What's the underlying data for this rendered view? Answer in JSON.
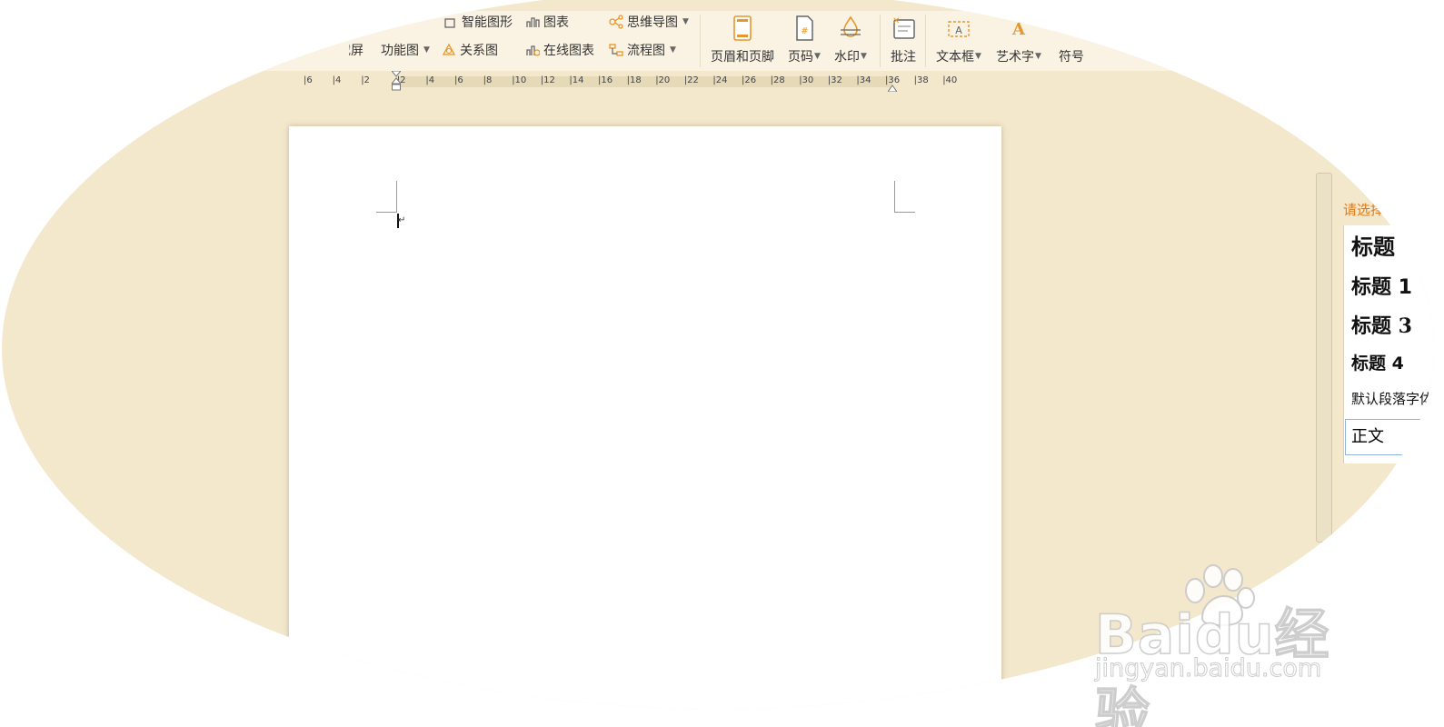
{
  "toolbar": {
    "row1": {
      "smart_shape": "智能图形",
      "chart": "图表",
      "mind_map": "思维导图"
    },
    "row2": {
      "screenshot": "截屏",
      "function_chart": "功能图",
      "relation_chart": "关系图",
      "online_chart": "在线图表",
      "flowchart": "流程图"
    },
    "big_buttons": {
      "header_footer": "页眉和页脚",
      "page_number": "页码",
      "watermark": "水印",
      "comment": "批注",
      "text_box": "文本框",
      "word_art": "艺术字",
      "symbol": "符号"
    },
    "accent": "#f0a030"
  },
  "ruler": {
    "ticks": [
      "6",
      "4",
      "2",
      "2",
      "4",
      "6",
      "8",
      "10",
      "12",
      "14",
      "16",
      "18",
      "20",
      "22",
      "24",
      "26",
      "28",
      "30",
      "32",
      "34",
      "36",
      "38",
      "40"
    ]
  },
  "style_pane": {
    "title": "请选择",
    "items": [
      {
        "label": "标题"
      },
      {
        "label": "标题 1"
      },
      {
        "label": "标题 3"
      },
      {
        "label": "标题 4"
      },
      {
        "label": "默认段落字体"
      }
    ],
    "selected": "正文"
  },
  "watermark": {
    "logo": "Baidu经验",
    "url": "jingyan.baidu.com"
  }
}
